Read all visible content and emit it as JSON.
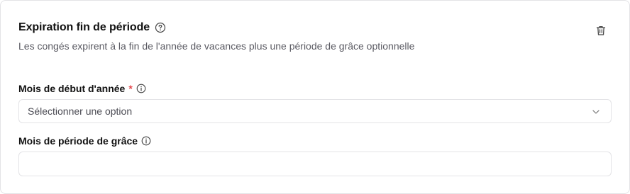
{
  "section": {
    "title": "Expiration fin de période",
    "description": "Les congés expirent à la fin de l'année de vacances plus une période de grâce optionnelle"
  },
  "fields": {
    "start_month": {
      "label": "Mois de début d'année",
      "required_marker": "*",
      "placeholder": "Sélectionner une option"
    },
    "grace_months": {
      "label": "Mois de période de grâce",
      "value": ""
    }
  },
  "icons": {
    "help": "help-circle-icon",
    "delete": "trash-icon",
    "info": "info-icon",
    "dropdown": "chevron-down-icon"
  },
  "colors": {
    "required": "#e5484d",
    "border": "#e3e3e6",
    "muted_text": "#5b5b63"
  }
}
